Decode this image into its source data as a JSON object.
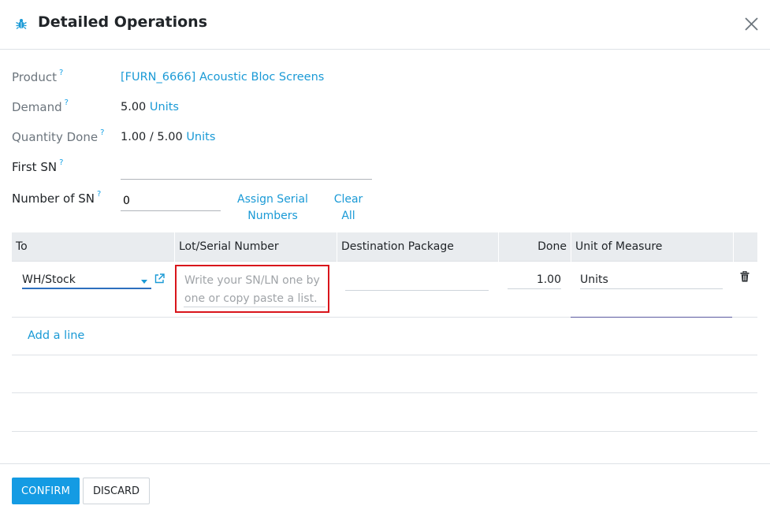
{
  "dialog": {
    "title": "Detailed Operations",
    "icon": "bug-icon",
    "accent_color": "#1a9ad6"
  },
  "fields": {
    "product": {
      "label": "Product",
      "help": "?",
      "value": "[FURN_6666] Acoustic Bloc Screens"
    },
    "demand": {
      "label": "Demand",
      "help": "?",
      "value": "5.00",
      "unit": "Units"
    },
    "quantity_done": {
      "label": "Quantity Done",
      "help": "?",
      "value": "1.00",
      "separator": "/",
      "total": "5.00",
      "unit": "Units"
    },
    "first_sn": {
      "label": "First SN",
      "help": "?",
      "value": ""
    },
    "number_of_sn": {
      "label": "Number of SN",
      "help": "?",
      "value": "0"
    }
  },
  "actions": {
    "assign_line1": "Assign Serial",
    "assign_line2": "Numbers",
    "clear_line1": "Clear",
    "clear_line2": "All"
  },
  "table": {
    "columns": [
      "To",
      "Lot/Serial Number",
      "Destination Package",
      "Done",
      "Unit of Measure"
    ],
    "row": {
      "to": "WH/Stock",
      "lot_placeholder": "Write your SN/LN one by one or copy paste a list.",
      "package": "",
      "done": "1.00",
      "uom": "Units"
    },
    "add_line": "Add a line"
  },
  "footer": {
    "confirm": "CONFIRM",
    "discard": "DISCARD"
  },
  "colors": {
    "primary_button": "#149be3",
    "highlight_border": "#d9151b",
    "header_row": "#e9ecef"
  }
}
